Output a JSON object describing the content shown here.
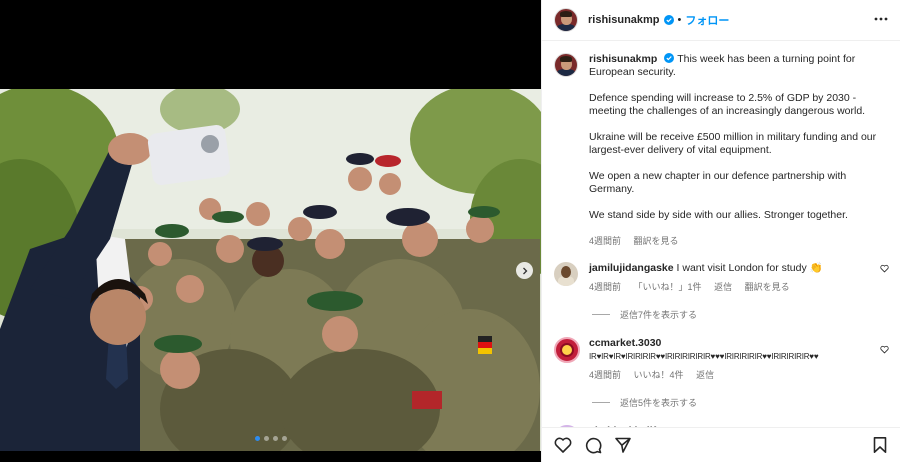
{
  "post": {
    "author": "rishisunakmp",
    "follow_label": "フォロー",
    "separator": "•",
    "caption": {
      "author": "rishisunakmp",
      "paragraphs": [
        "This week has been a turning point for European security.",
        "Defence spending will increase to 2.5% of GDP by 2030 - meeting the challenges of an increasingly dangerous world.",
        "Ukraine will be receive £500 million in military funding and our largest-ever delivery of vital equipment.",
        "We open a new chapter in our defence partnership with Germany.",
        "We stand side by side with our allies. Stronger together."
      ],
      "time": "4週間前",
      "translate": "翻訳を見る"
    },
    "carousel": {
      "count": 4,
      "active": 0
    }
  },
  "comments": [
    {
      "user": "jamilujidangaske",
      "text": "I want visit London for study 👏",
      "time": "4週間前",
      "likes": "「いいね！」1件",
      "reply": "返信",
      "translate": "翻訳を見る",
      "view_replies": "返信7件を表示する"
    },
    {
      "user": "ccmarket.3030",
      "text": "IR♥IR♥IR♥IRIRIRIR♥♥IRIRIRIRIRIR♥♥♥IRIRIRIRIR♥♥IRIRIRIRIR♥♥",
      "time": "4週間前",
      "likes": "いいね！4件",
      "reply": "返信",
      "view_replies": "返信5件を表示する"
    },
    {
      "user": "shabinakhalifa"
    }
  ],
  "colors": {
    "accent": "#0095f6",
    "verified": "#0095f6",
    "muted": "#737373",
    "carousel_dot_active": "#2d8cf0"
  },
  "icons": {
    "header_more": "more-horizontal-icon",
    "like": "heart-outline-icon",
    "comment": "comment-bubble-icon",
    "share": "paper-plane-icon",
    "save": "bookmark-icon",
    "next": "chevron-right-icon"
  }
}
